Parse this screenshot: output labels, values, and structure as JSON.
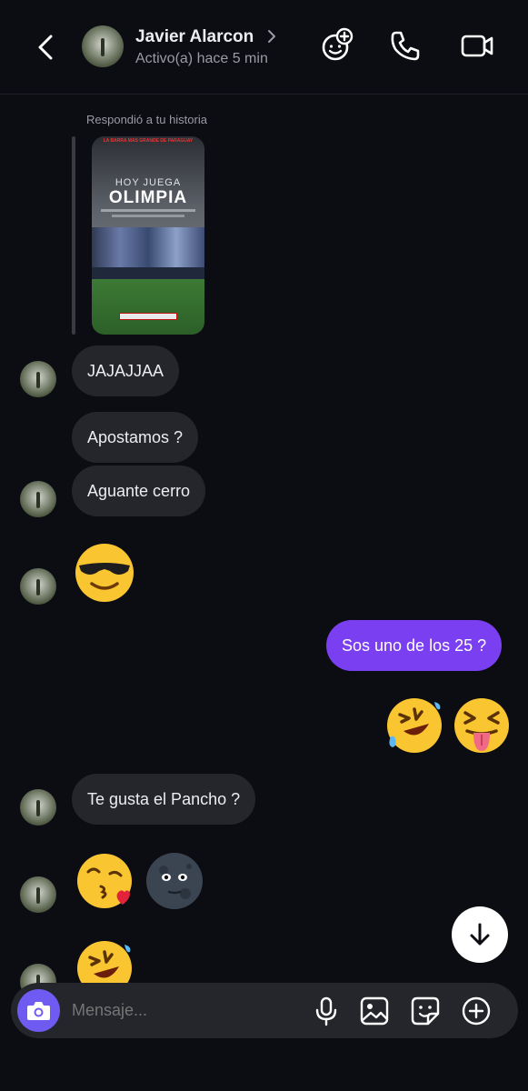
{
  "header": {
    "contact_name": "Javier Alarcon",
    "status": "Activo(a) hace 5 min",
    "icons": [
      "back-arrow-icon",
      "chevron-right-icon",
      "effects-add-icon",
      "phone-icon",
      "video-camera-icon"
    ]
  },
  "story_reply": {
    "label": "Respondió a tu historia",
    "story_top_text": "LA BARRA MAS GRANDE DE PARAGUAY",
    "story_line1": "HOY JUEGA",
    "story_line2": "OLIMPIA"
  },
  "messages": [
    {
      "id": "m1",
      "from": "them",
      "type": "text",
      "text": "JAJAJJAA"
    },
    {
      "id": "m2",
      "from": "them",
      "type": "text",
      "text": "Apostamos ?"
    },
    {
      "id": "m3",
      "from": "them",
      "type": "text",
      "text": "Aguante cerro"
    },
    {
      "id": "m4",
      "from": "them",
      "type": "emoji",
      "emoji": [
        "smiling-face-with-sunglasses"
      ]
    },
    {
      "id": "m5",
      "from": "me",
      "type": "text",
      "text": "Sos uno de los 25 ?"
    },
    {
      "id": "m6",
      "from": "me",
      "type": "emoji",
      "emoji": [
        "rolling-on-the-floor-laughing",
        "squinting-face-with-tongue"
      ]
    },
    {
      "id": "m7",
      "from": "them",
      "type": "text",
      "text": "Te gusta el Pancho ?"
    },
    {
      "id": "m8",
      "from": "them",
      "type": "emoji",
      "emoji": [
        "face-blowing-a-kiss",
        "new-moon-face"
      ]
    },
    {
      "id": "m9",
      "from": "them",
      "type": "emoji",
      "emoji": [
        "rolling-on-the-floor-laughing"
      ]
    }
  ],
  "scroll_button": {
    "icon": "arrow-down-icon"
  },
  "composer": {
    "placeholder": "Mensaje...",
    "icons": [
      "camera-icon",
      "microphone-icon",
      "gallery-icon",
      "sticker-icon",
      "plus-circle-icon"
    ]
  },
  "colors": {
    "background": "#0c0d12",
    "incoming_bubble": "#25262c",
    "outgoing_bubble": "#7b3ff2",
    "camera_button": "#6f5bf2",
    "secondary_text": "#9a9ba3"
  }
}
